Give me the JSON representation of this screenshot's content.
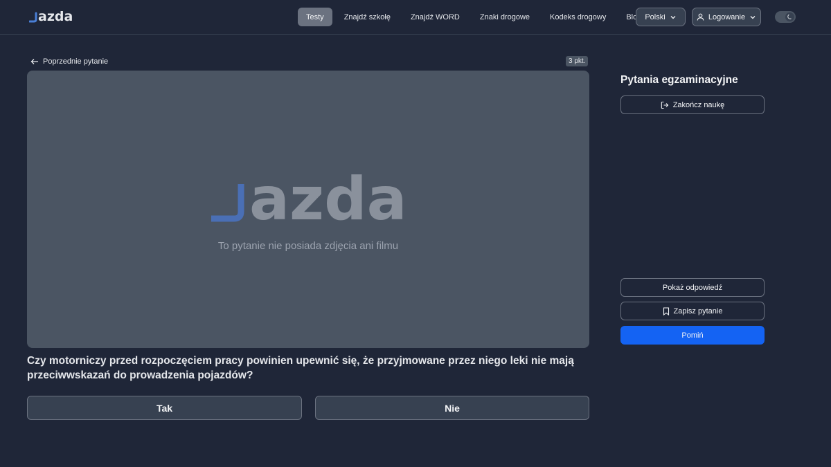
{
  "header": {
    "logo_text": "jazda",
    "nav": [
      {
        "label": "Testy",
        "active": true
      },
      {
        "label": "Znajdź szkołę",
        "active": false
      },
      {
        "label": "Znajdź WORD",
        "active": false
      },
      {
        "label": "Znaki drogowe",
        "active": false
      },
      {
        "label": "Kodeks drogowy",
        "active": false
      },
      {
        "label": "Blog",
        "active": false
      }
    ],
    "language": "Polski",
    "login": "Logowanie",
    "theme_toggle": "dark"
  },
  "main": {
    "prev_question": "Poprzednie pytanie",
    "points": "3 pkt.",
    "media_message": "To pytanie nie posiada zdjęcia ani filmu",
    "question": "Czy motorniczy przed rozpoczęciem pracy powinien upewnić się, że przyjmowane przez niego leki nie mają przeciwwskazań do prowadzenia pojazdów?",
    "answers": [
      "Tak",
      "Nie"
    ]
  },
  "sidebar": {
    "title": "Pytania egzaminacyjne",
    "finish": "Zakończ naukę",
    "show_answer": "Pokaż odpowiedź",
    "save_question": "Zapisz pytanie",
    "skip": "Pomiń"
  },
  "colors": {
    "background": "#1f2638",
    "accent": "#1463f3",
    "logo_mark": "#4a6fb5",
    "media_background": "#4b5563"
  }
}
